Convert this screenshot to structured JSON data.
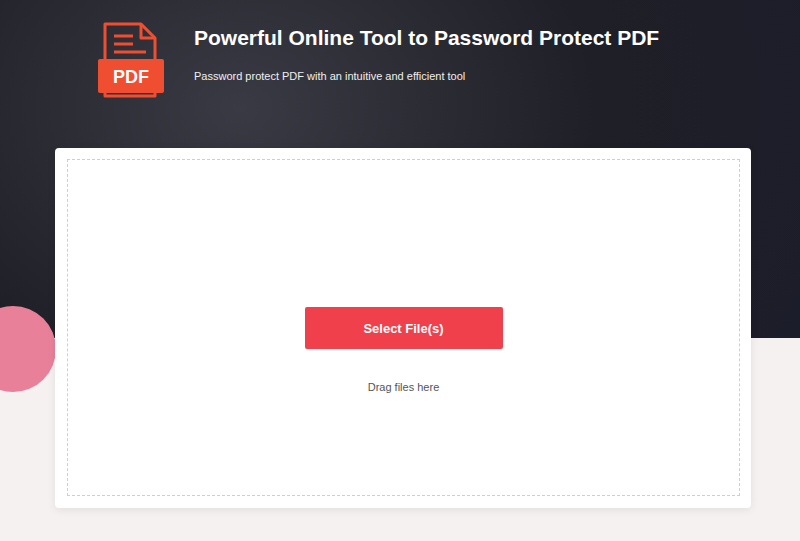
{
  "logo": {
    "label": "PDF"
  },
  "header": {
    "title": "Powerful Online Tool to Password Protect PDF",
    "subtitle": "Password protect PDF with an intuitive and efficient tool"
  },
  "upload": {
    "button": "Select File(s)",
    "hint": "Drag files here"
  }
}
